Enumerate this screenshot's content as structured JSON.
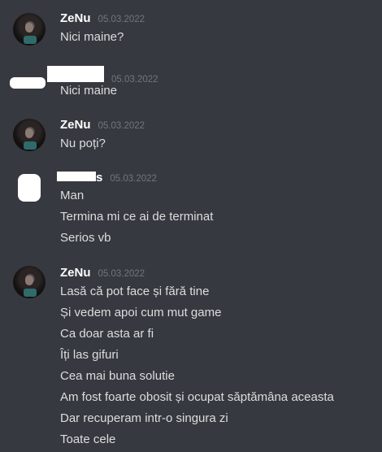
{
  "messages": [
    {
      "username": "ZeNu",
      "timestamp": "05.03.2022",
      "avatar": "zenu-avatar-photo",
      "lines": [
        "Nici maine?"
      ]
    },
    {
      "username": "",
      "timestamp": "05.03.2022",
      "avatar": "redacted-avatar",
      "lines": [
        "Nici maine"
      ]
    },
    {
      "username": "ZeNu",
      "timestamp": "05.03.2022",
      "avatar": "zenu-avatar-photo",
      "lines": [
        "Nu poți?"
      ]
    },
    {
      "username": "",
      "username_visible_suffix": "s",
      "timestamp": "05.03.2022",
      "avatar": "redacted-avatar",
      "lines": [
        "Man",
        "Termina mi ce ai de terminat",
        "Serios vb"
      ]
    },
    {
      "username": "ZeNu",
      "timestamp": "05.03.2022",
      "avatar": "zenu-avatar-photo",
      "lines": [
        "Lasă că pot face și fără tine",
        "Și vedem apoi cum mut game",
        "Ca doar asta ar fi",
        "Îți las gifuri",
        "Cea mai buna solutie",
        "Am fost foarte obosit și ocupat săptămâna aceasta",
        "Dar recuperam intr-o singura zi",
        "Toate cele"
      ]
    }
  ],
  "colors": {
    "background": "#36393f",
    "username": "#ffffff",
    "timestamp": "#72767d",
    "message_text": "#dcddde"
  }
}
